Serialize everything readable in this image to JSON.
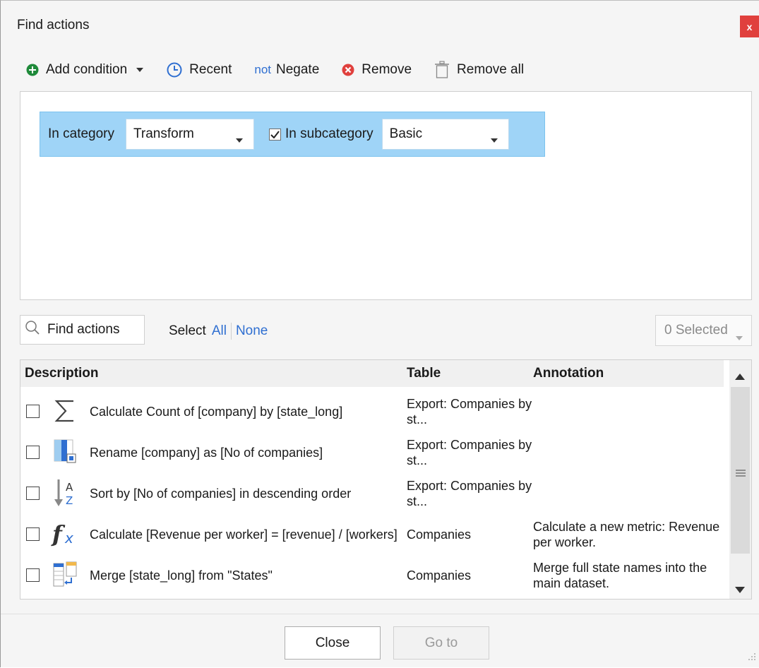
{
  "window": {
    "title": "Find actions",
    "close_glyph": "x"
  },
  "toolbar": {
    "add_condition": "Add condition",
    "recent": "Recent",
    "negate_prefix": "not",
    "negate": "Negate",
    "remove": "Remove",
    "remove_all": "Remove all"
  },
  "condition": {
    "category_label": "In category",
    "category_value": "Transform",
    "subcategory_checked": true,
    "subcategory_label": "In subcategory",
    "subcategory_value": "Basic"
  },
  "search": {
    "find_button": "Find actions",
    "select_label": "Select",
    "select_all": "All",
    "select_none": "None",
    "selected_count": "0 Selected"
  },
  "grid": {
    "columns": {
      "description": "Description",
      "table": "Table",
      "annotation": "Annotation"
    },
    "rows": [
      {
        "icon": "sigma-icon",
        "description": "Calculate Count of [company] by [state_long]",
        "table": "Export: Companies by st...",
        "annotation": ""
      },
      {
        "icon": "rename-column-icon",
        "description": "Rename [company] as [No of companies]",
        "table": "Export: Companies by st...",
        "annotation": ""
      },
      {
        "icon": "sort-az-icon",
        "description": "Sort by [No of companies] in descending order",
        "table": "Export: Companies by st...",
        "annotation": ""
      },
      {
        "icon": "function-icon",
        "description": "Calculate [Revenue per worker] = [revenue] / [workers]",
        "table": "Companies",
        "annotation": "Calculate a new metric: Revenue per worker."
      },
      {
        "icon": "merge-icon",
        "description": "Merge [state_long] from \"States\"",
        "table": "Companies",
        "annotation": "Merge full state names into the main dataset."
      }
    ]
  },
  "footer": {
    "close": "Close",
    "goto": "Go to"
  },
  "colors": {
    "accent_blue": "#2f6fd1",
    "condition_bg": "#9fd4f7",
    "add_green": "#1f8a3a",
    "remove_red": "#e0403d"
  }
}
